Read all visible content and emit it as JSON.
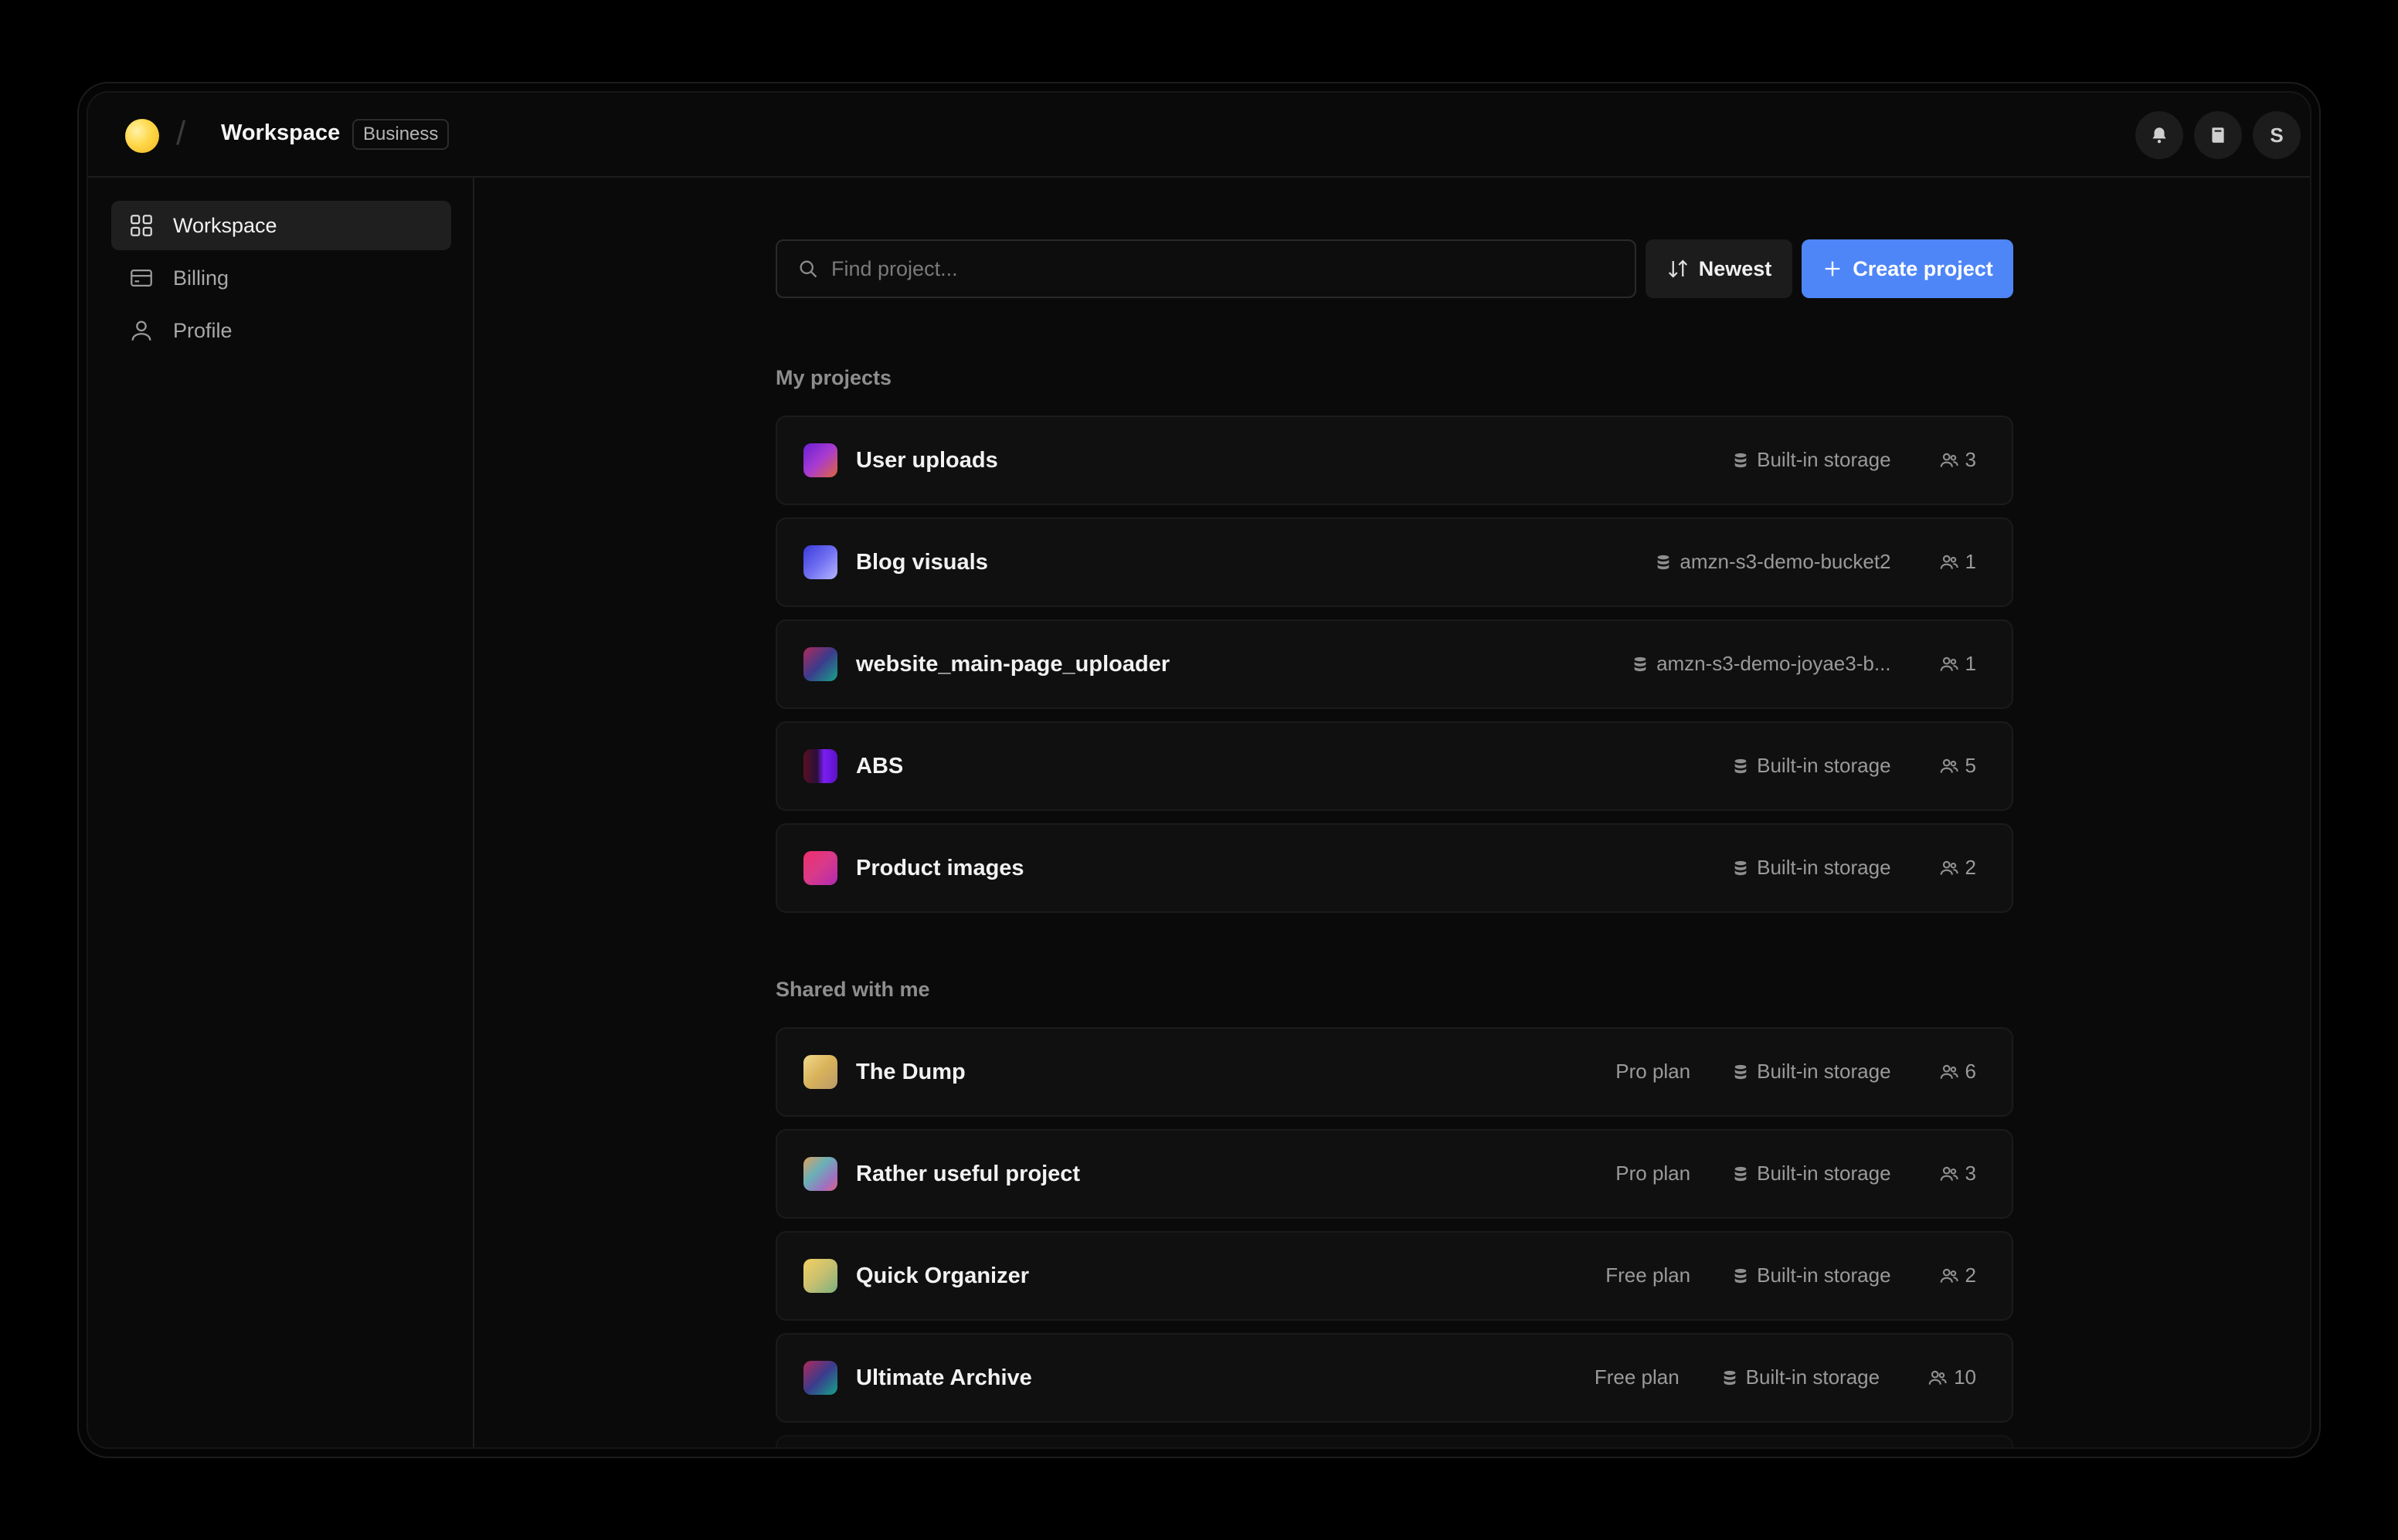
{
  "header": {
    "workspace_title": "Workspace",
    "plan_badge": "Business",
    "avatar_initial": "S"
  },
  "sidebar": {
    "items": [
      {
        "label": "Workspace",
        "icon": "grid-icon",
        "active": true
      },
      {
        "label": "Billing",
        "icon": "card-icon",
        "active": false
      },
      {
        "label": "Profile",
        "icon": "user-icon",
        "active": false
      }
    ]
  },
  "toolbar": {
    "search_placeholder": "Find project...",
    "sort_label": "Newest",
    "create_label": "Create project"
  },
  "sections": {
    "my_projects": "My projects",
    "shared_with_me": "Shared with me"
  },
  "my_projects": [
    {
      "name": "User uploads",
      "storage": "Built-in storage",
      "members": "3"
    },
    {
      "name": "Blog visuals",
      "storage": "amzn-s3-demo-bucket2",
      "members": "1"
    },
    {
      "name": "website_main-page_uploader",
      "storage": "amzn-s3-demo-joyae3-b...",
      "members": "1"
    },
    {
      "name": "ABS",
      "storage": "Built-in storage",
      "members": "5"
    },
    {
      "name": "Product images",
      "storage": "Built-in storage",
      "members": "2"
    }
  ],
  "shared_projects": [
    {
      "name": "The Dump",
      "plan": "Pro plan",
      "storage": "Built-in storage",
      "members": "6"
    },
    {
      "name": "Rather useful project",
      "plan": "Pro plan",
      "storage": "Built-in storage",
      "members": "3"
    },
    {
      "name": "Quick Organizer",
      "plan": "Free plan",
      "storage": "Built-in storage",
      "members": "2"
    },
    {
      "name": "Ultimate Archive",
      "plan": "Free plan",
      "storage": "Built-in storage",
      "members": "10"
    }
  ],
  "colors": {
    "accent": "#4e86f7",
    "logo": "#ffd84a"
  }
}
